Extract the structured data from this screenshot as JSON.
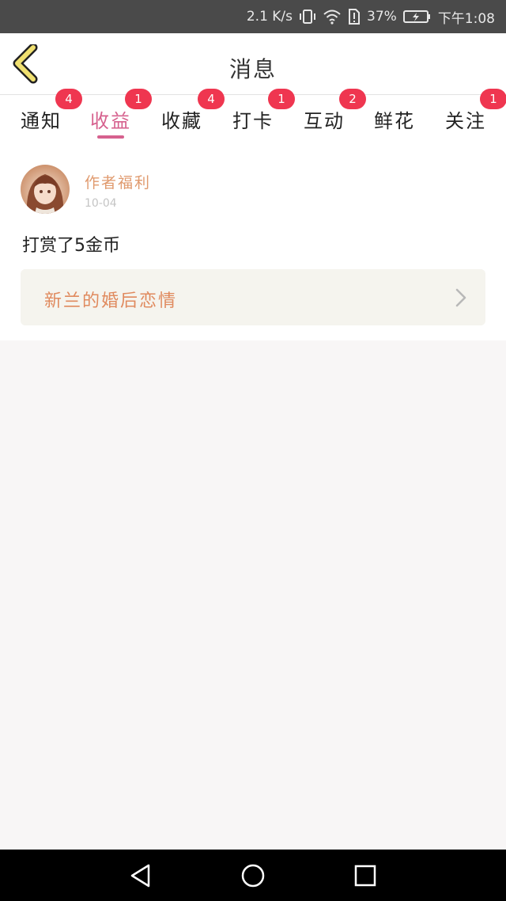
{
  "status_bar": {
    "speed": "2.1 K/s",
    "battery": "37%",
    "time": "下午1:08"
  },
  "header": {
    "title": "消息"
  },
  "tabs": [
    {
      "label": "通知",
      "badge": "4"
    },
    {
      "label": "收益",
      "badge": "1",
      "active": true
    },
    {
      "label": "收藏",
      "badge": "4"
    },
    {
      "label": "打卡",
      "badge": "1"
    },
    {
      "label": "互动",
      "badge": "2"
    },
    {
      "label": "鲜花",
      "badge": ""
    },
    {
      "label": "关注",
      "badge": "1"
    }
  ],
  "message": {
    "sender": "作者福利",
    "date": "10-04",
    "text": "打赏了5金币",
    "book_title": "新兰的婚后恋情"
  },
  "icons": {
    "back": "back-chevron-icon",
    "card_arrow": "chevron-right-icon",
    "nav_back": "triangle-back-icon",
    "nav_home": "circle-home-icon",
    "nav_recent": "square-recent-icon"
  },
  "colors": {
    "accent": "#d6618e",
    "badge": "#ef3650",
    "sender": "#e09a6e",
    "book_title": "#e08a5e",
    "back_arrow_fill": "#f0e070"
  }
}
